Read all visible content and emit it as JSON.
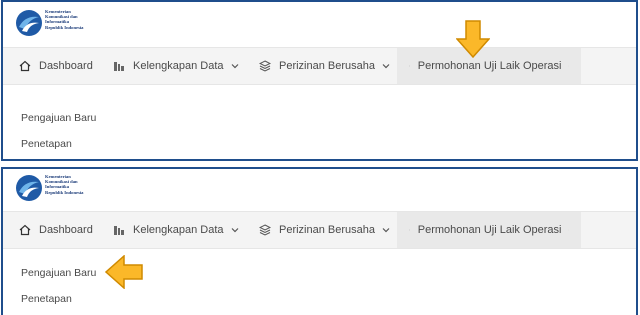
{
  "brand": {
    "logo_lines": [
      "Kementerian",
      "Komunikasi dan",
      "Informatika",
      "Republik Indonesia"
    ]
  },
  "nav": {
    "items": [
      {
        "label": "Dashboard",
        "icon": "home-icon"
      },
      {
        "label": "Kelengkapan Data",
        "icon": "data-icon"
      },
      {
        "label": "Perizinan Berusaha",
        "icon": "layers-icon"
      },
      {
        "label": "Permohonan Uji Laik Operasi",
        "icon": "layers-icon"
      }
    ]
  },
  "submenu": {
    "items": [
      "Pengajuan Baru",
      "Penetapan"
    ]
  },
  "colors": {
    "panel_border": "#1f4e8c",
    "arrow_fill": "#fbb829",
    "arrow_stroke": "#d08a00",
    "navbar_bg": "#f4f4f4"
  }
}
